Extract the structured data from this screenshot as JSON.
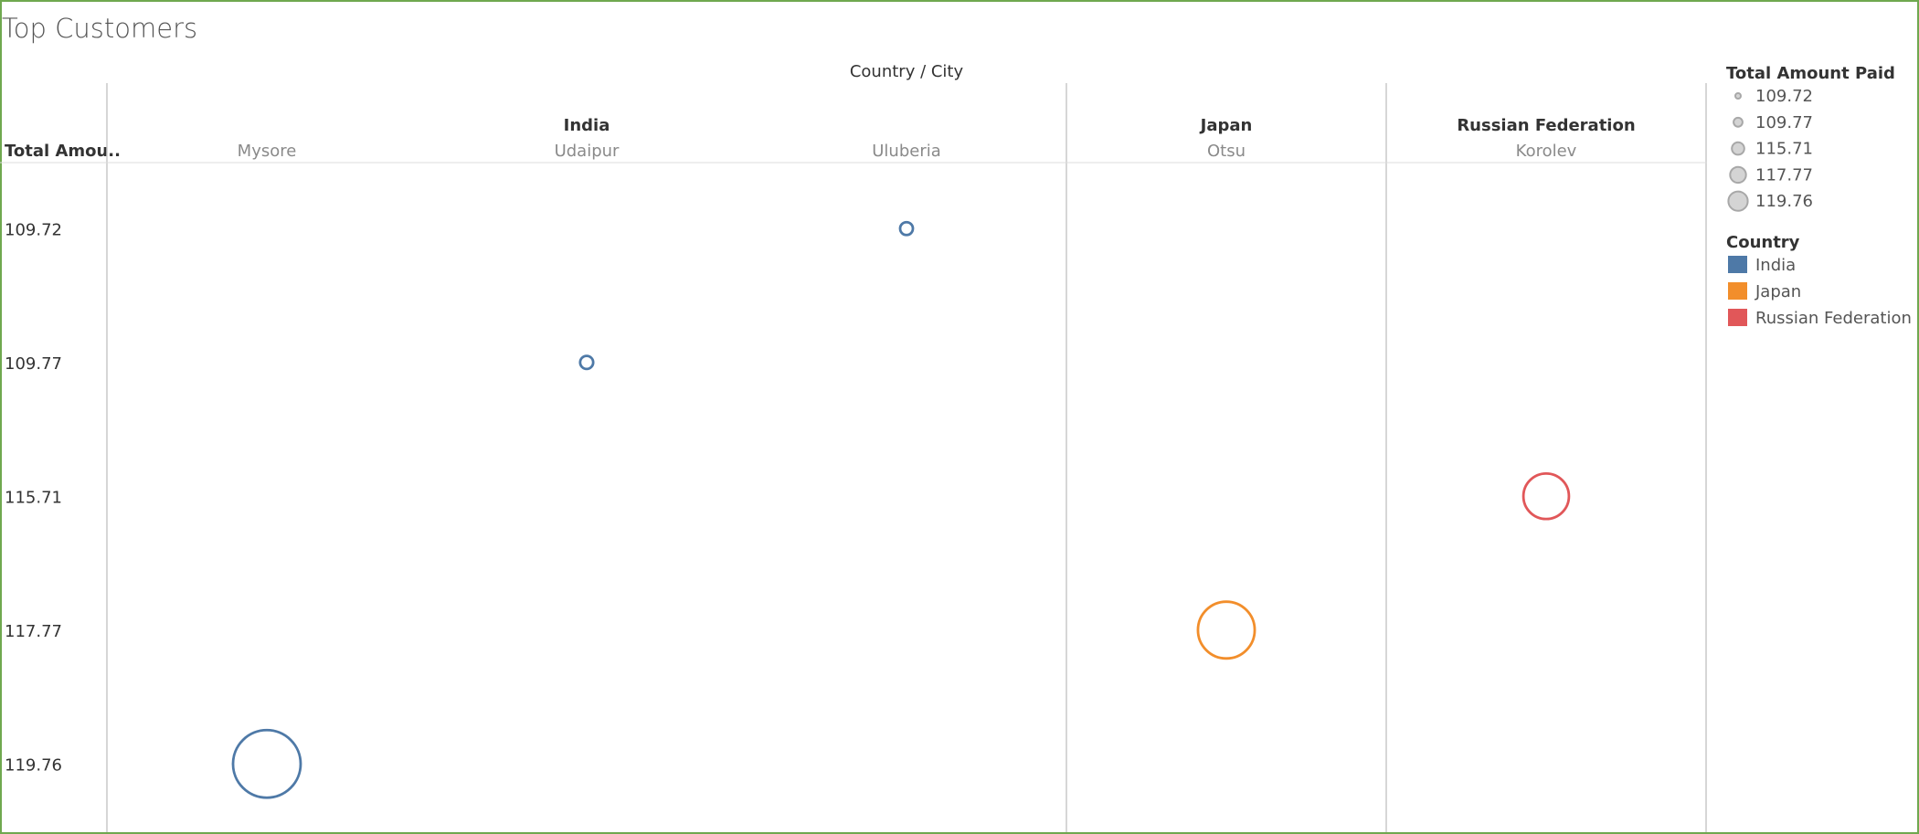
{
  "title": "Top Customers",
  "chart_data": {
    "type": "scatter",
    "title": "Top Customers",
    "column_header": "Country / City",
    "row_header": "Total Amou..",
    "countries": [
      {
        "name": "India",
        "cities": [
          "Mysore",
          "Udaipur",
          "Uluberia"
        ]
      },
      {
        "name": "Japan",
        "cities": [
          "Otsu"
        ]
      },
      {
        "name": "Russian Federation",
        "cities": [
          "Korolev"
        ]
      }
    ],
    "rows": [
      "109.72",
      "109.77",
      "115.71",
      "117.77",
      "119.76"
    ],
    "points": [
      {
        "country": "India",
        "city": "Uluberia",
        "total_amount_paid": 109.72
      },
      {
        "country": "India",
        "city": "Udaipur",
        "total_amount_paid": 109.77
      },
      {
        "country": "Russian Federation",
        "city": "Korolev",
        "total_amount_paid": 115.71
      },
      {
        "country": "Japan",
        "city": "Otsu",
        "total_amount_paid": 117.77
      },
      {
        "country": "India",
        "city": "Mysore",
        "total_amount_paid": 119.76
      }
    ],
    "size_legend": {
      "title": "Total Amount Paid",
      "values": [
        "109.72",
        "109.77",
        "115.71",
        "117.77",
        "119.76"
      ]
    },
    "color_legend": {
      "title": "Country",
      "items": [
        {
          "label": "India",
          "color": "#4e79a7"
        },
        {
          "label": "Japan",
          "color": "#f28e2b"
        },
        {
          "label": "Russian Federation",
          "color": "#e15759"
        }
      ]
    }
  }
}
